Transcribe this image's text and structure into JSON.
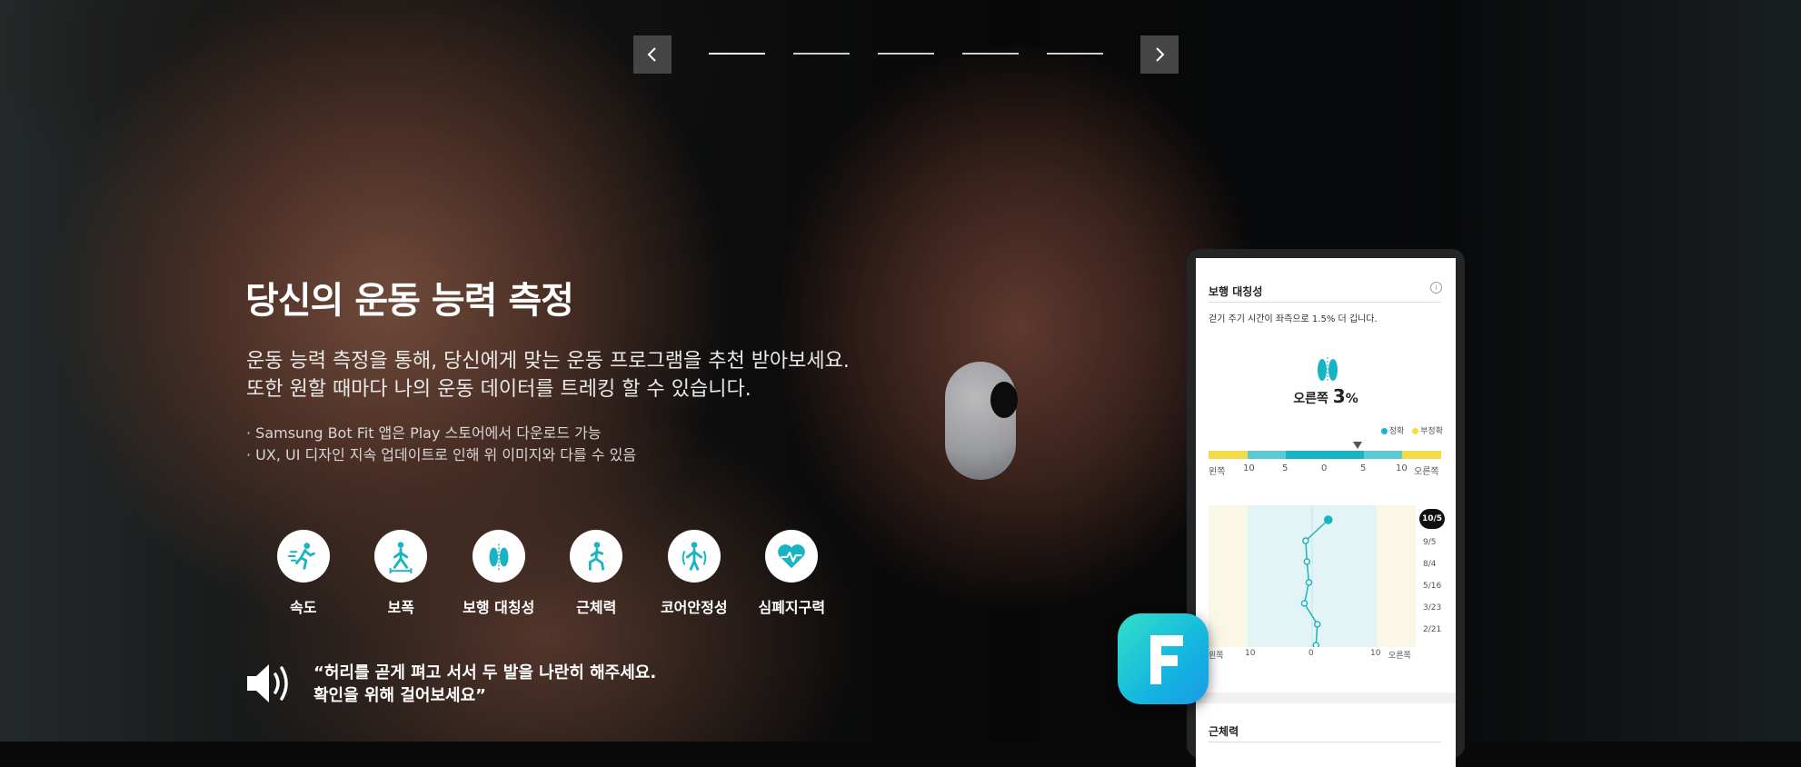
{
  "carousel": {
    "slide_count": 5,
    "active_index": 0
  },
  "headline": "당신의 운동 능력 측정",
  "description": [
    "운동 능력 측정을 통해, 당신에게 맞는 운동 프로그램을 추천 받아보세요.",
    "또한 원할 때마다 나의 운동 데이터를 트레킹 할 수 있습니다."
  ],
  "notes": [
    "· Samsung Bot Fit 앱은 Play 스토어에서 다운로드 가능",
    "· UX, UI 디자인 지속 업데이트로 인해 위 이미지와 다를 수 있음"
  ],
  "features": [
    {
      "label": "속도",
      "icon": "running-icon"
    },
    {
      "label": "보폭",
      "icon": "stride-icon"
    },
    {
      "label": "보행 대칭성",
      "icon": "footprints-icon"
    },
    {
      "label": "근체력",
      "icon": "lunge-icon"
    },
    {
      "label": "코어안정성",
      "icon": "core-stability-icon"
    },
    {
      "label": "심폐지구력",
      "icon": "heart-rate-icon"
    }
  ],
  "voice_prompt": {
    "line1": "“허리를 곧게 펴고 서서 두 발을 나란히 해주세요.",
    "line2": "확인을 위해 걸어보세요”"
  },
  "phone": {
    "section_title": "보행 대칭성",
    "info_icon": "i",
    "subtitle": "걷기 주기 시간이 좌측으로 1.5% 더 깁니다.",
    "result_side": "오른쪽",
    "result_value": "3",
    "result_unit": "%",
    "legend": [
      {
        "label": "정확",
        "color": "#18b4c2"
      },
      {
        "label": "부정확",
        "color": "#f2dc4a"
      }
    ],
    "scale_labels": [
      "왼쪽",
      "10",
      "5",
      "0",
      "5",
      "10",
      "오른쪽"
    ],
    "dates": [
      "10/5",
      "9/5",
      "8/4",
      "5/16",
      "3/23",
      "2/21"
    ],
    "trend_x_labels": [
      "왼쪽",
      "10",
      "0",
      "10",
      "오른쪽"
    ],
    "trend_points": [
      2.5,
      -1,
      -0.8,
      -0.5,
      -1.2,
      0.8,
      0.6
    ],
    "next_section_title": "근체력"
  },
  "colors": {
    "accurate": "#18b4c2",
    "inaccurate": "#f2dc4a",
    "nav_button": "#454545"
  }
}
